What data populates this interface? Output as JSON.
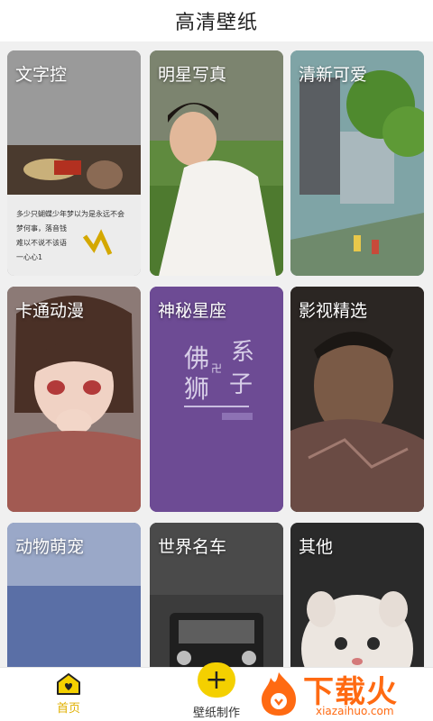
{
  "header": {
    "title": "高清壁纸"
  },
  "categories": [
    {
      "label": "文字控"
    },
    {
      "label": "明星写真"
    },
    {
      "label": "清新可爱"
    },
    {
      "label": "卡通动漫"
    },
    {
      "label": "神秘星座"
    },
    {
      "label": "影视精选"
    },
    {
      "label": "动物萌宠"
    },
    {
      "label": "世界名车"
    },
    {
      "label": "其他"
    }
  ],
  "card_text": {
    "handwriting": [
      "多少只蝴蝶少年梦以为是永远不会",
      "梦何事，落音钱",
      "难以不说不该语",
      "一心心1"
    ],
    "poster_line1": "佛",
    "poster_line2": "狮",
    "poster_side1": "系",
    "poster_side2": "子",
    "poster_mark": "卍"
  },
  "tabbar": {
    "home_label": "首页",
    "make_label": "壁纸制作",
    "make_icon": "+"
  },
  "watermark": {
    "brand": "下载火",
    "url": "xiazaihuo.com"
  },
  "colors": {
    "accent": "#f4d000",
    "home_active": "#e0b000",
    "watermark": "#ff6a12"
  }
}
